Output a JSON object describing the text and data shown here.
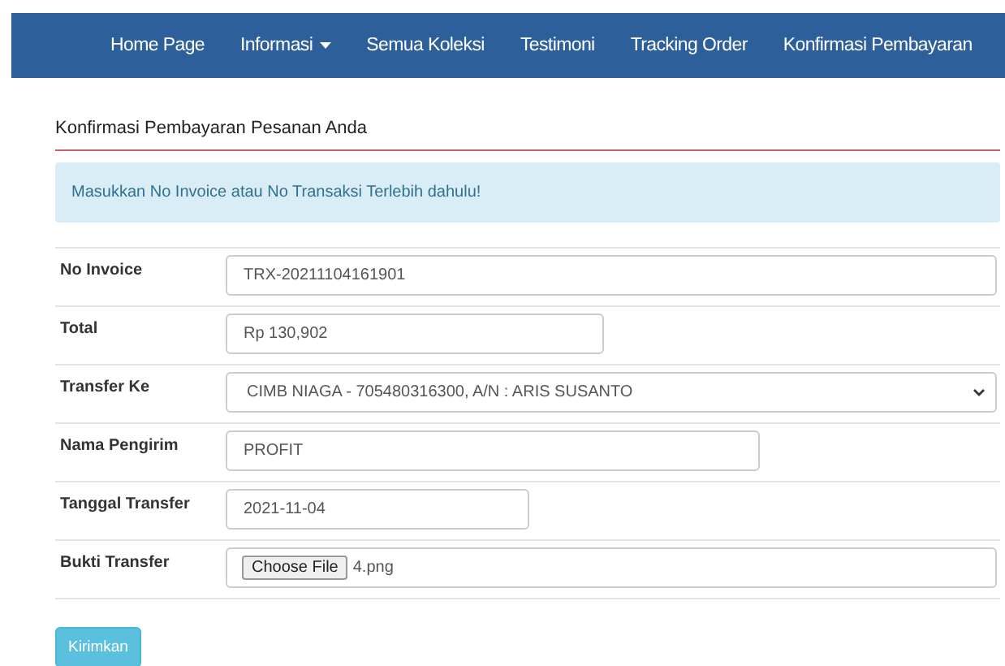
{
  "nav": {
    "items": [
      {
        "label": "Home Page",
        "dropdown": false
      },
      {
        "label": "Informasi",
        "dropdown": true
      },
      {
        "label": "Semua Koleksi",
        "dropdown": false
      },
      {
        "label": "Testimoni",
        "dropdown": false
      },
      {
        "label": "Tracking Order",
        "dropdown": false
      },
      {
        "label": "Konfirmasi Pembayaran",
        "dropdown": false
      }
    ]
  },
  "heading": "Konfirmasi Pembayaran Pesanan Anda",
  "alert": "Masukkan No Invoice atau No Transaksi Terlebih dahulu!",
  "form": {
    "rows": [
      {
        "label": "No Invoice",
        "kind": "text",
        "value": "TRX-20211104161901"
      },
      {
        "label": "Total",
        "kind": "text",
        "value": "Rp 130,902"
      },
      {
        "label": "Transfer Ke",
        "kind": "select",
        "value": "CIMB NIAGA - 705480316300, A/N : ARIS SUSANTO"
      },
      {
        "label": "Nama Pengirim",
        "kind": "text",
        "value": "PROFIT"
      },
      {
        "label": "Tanggal Transfer",
        "kind": "text",
        "value": "2021-11-04"
      },
      {
        "label": "Bukti Transfer",
        "kind": "file",
        "button": "Choose File",
        "value": "4.png"
      }
    ],
    "submit": "Kirimkan"
  }
}
